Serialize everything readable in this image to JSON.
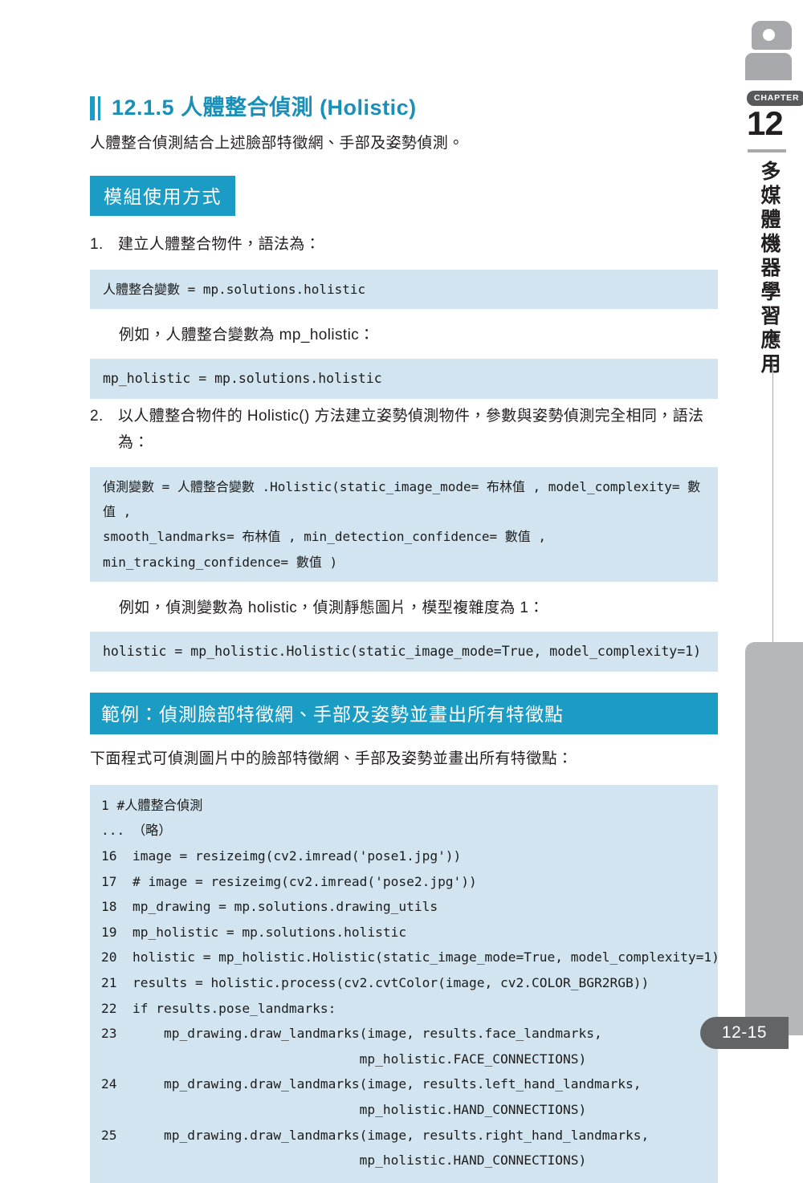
{
  "section": {
    "heading": "12.1.5  人體整合偵測 (Holistic)",
    "intro": "人體整合偵測結合上述臉部特徵網、手部及姿勢偵測。"
  },
  "module_usage": {
    "badge": "模組使用方式",
    "items": [
      {
        "marker": "1.",
        "text": "建立人體整合物件，語法為：",
        "syntax": "人體整合變數 = mp.solutions.holistic",
        "example_note": "例如，人體整合變數為 mp_holistic：",
        "example_code": "mp_holistic = mp.solutions.holistic"
      },
      {
        "marker": "2.",
        "text": "以人體整合物件的 Holistic() 方法建立姿勢偵測物件，參數與姿勢偵測完全相同，語法為：",
        "syntax": "偵測變數 = 人體整合變數 .Holistic(static_image_mode= 布林值 , model_complexity= 數值 ,\nsmooth_landmarks= 布林值 , min_detection_confidence= 數值 , min_tracking_confidence= 數值 )",
        "example_note": "例如，偵測變數為 holistic，偵測靜態圖片，模型複雜度為 1：",
        "example_code": "holistic = mp_holistic.Holistic(static_image_mode=True, model_complexity=1)"
      }
    ]
  },
  "example_section": {
    "badge": "範例：偵測臉部特徵網、手部及姿勢並畫出所有特徵點",
    "description": "下面程式可偵測圖片中的臉部特徵網、手部及姿勢並畫出所有特徵點：",
    "listing": [
      "1 #人體整合偵測",
      "... （略）",
      "16  image = resizeimg(cv2.imread('pose1.jpg'))",
      "17  # image = resizeimg(cv2.imread('pose2.jpg'))",
      "18  mp_drawing = mp.solutions.drawing_utils",
      "19  mp_holistic = mp.solutions.holistic",
      "20  holistic = mp_holistic.Holistic(static_image_mode=True, model_complexity=1)",
      "21  results = holistic.process(cv2.cvtColor(image, cv2.COLOR_BGR2RGB))",
      "22  if results.pose_landmarks:",
      "23      mp_drawing.draw_landmarks(image, results.face_landmarks,",
      "                                 mp_holistic.FACE_CONNECTIONS)",
      "24      mp_drawing.draw_landmarks(image, results.left_hand_landmarks,",
      "                                 mp_holistic.HAND_CONNECTIONS)",
      "25      mp_drawing.draw_landmarks(image, results.right_hand_landmarks,",
      "                                 mp_holistic.HAND_CONNECTIONS)"
    ]
  },
  "chapter_rail": {
    "label": "CHAPTER",
    "number": "12",
    "vertical_title": "多媒體機器學習應用"
  },
  "footer": {
    "page_number": "12-15"
  },
  "colors": {
    "teal": "#1a9cc4",
    "heading_teal": "#1a8fb8",
    "code_bg": "#d2e4ef",
    "gray_tab": "#b5b7b9",
    "dark_gray": "#636466"
  }
}
